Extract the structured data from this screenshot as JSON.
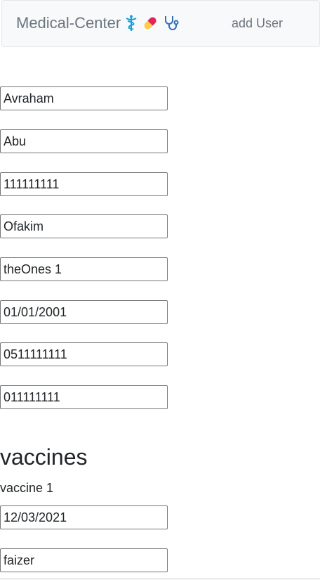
{
  "navbar": {
    "brand": "Medical-Center",
    "brand_icons": [
      "caduceus-icon",
      "pill-icon",
      "stethoscope-icon"
    ],
    "add_user_label": "add User"
  },
  "form": {
    "first_name": "Avraham",
    "last_name": "Abu",
    "id_number": "111111111",
    "city": "Ofakim",
    "street": "theOnes 1",
    "birth_date": "01/01/2001",
    "phone": "0511111111",
    "mobile": "011111111"
  },
  "vaccines": {
    "title": "vaccines",
    "items": [
      {
        "label": "vaccine 1",
        "date": "12/03/2021",
        "manufacturer": "faizer"
      }
    ]
  },
  "colors": {
    "navbar_bg": "#f8f9fa",
    "brand_text": "#6c757d",
    "icon_teal": "#1a9fd8",
    "icon_pill_red": "#e0245e",
    "icon_pill_yellow": "#ffcc4d",
    "icon_stethoscope": "#2f6fb5"
  }
}
